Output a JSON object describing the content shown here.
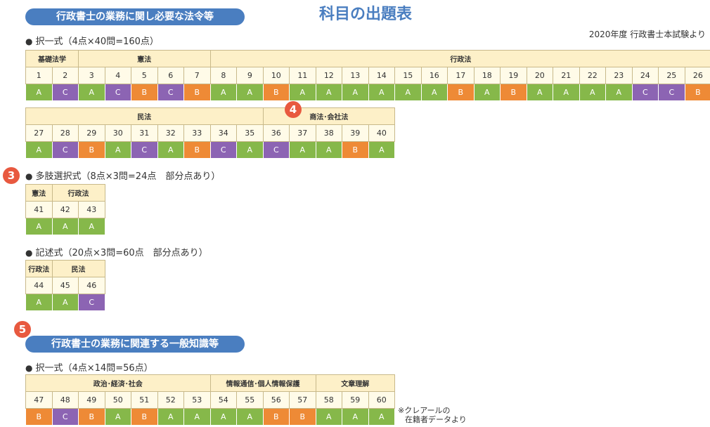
{
  "header": {
    "main_title": "科目の出題表",
    "source_note": "2020年度 行政書士本試験より",
    "section1_pill": "行政書士の業務に関し必要な法令等",
    "section2_pill": "行政書士の業務に関連する一般知識等"
  },
  "badges": {
    "b3": "3",
    "b4": "4",
    "b5": "5"
  },
  "block_choice1": {
    "heading": "択一式（4点×40問=160点）",
    "row1": {
      "groups": [
        {
          "label": "基礎法学",
          "span": 2
        },
        {
          "label": "憲法",
          "span": 5
        },
        {
          "label": "行政法",
          "span": 19
        }
      ],
      "nums": [
        "1",
        "2",
        "3",
        "4",
        "5",
        "6",
        "7",
        "8",
        "9",
        "10",
        "11",
        "12",
        "13",
        "14",
        "15",
        "16",
        "17",
        "18",
        "19",
        "20",
        "21",
        "22",
        "23",
        "24",
        "25",
        "26"
      ],
      "levels": [
        "A",
        "C",
        "A",
        "C",
        "B",
        "C",
        "B",
        "A",
        "A",
        "B",
        "A",
        "A",
        "A",
        "A",
        "A",
        "A",
        "B",
        "A",
        "B",
        "A",
        "A",
        "A",
        "A",
        "C",
        "C",
        "B"
      ]
    },
    "row2": {
      "groups": [
        {
          "label": "民法",
          "span": 9
        },
        {
          "label": "商法･会社法",
          "span": 5
        }
      ],
      "nums": [
        "27",
        "28",
        "29",
        "30",
        "31",
        "32",
        "33",
        "34",
        "35",
        "36",
        "37",
        "38",
        "39",
        "40"
      ],
      "levels": [
        "A",
        "C",
        "B",
        "A",
        "C",
        "A",
        "B",
        "C",
        "A",
        "C",
        "A",
        "A",
        "B",
        "A"
      ]
    }
  },
  "block_multi": {
    "heading": "多肢選択式（8点×3問=24点　部分点あり）",
    "groups": [
      {
        "label": "憲法",
        "span": 1
      },
      {
        "label": "行政法",
        "span": 2
      }
    ],
    "nums": [
      "41",
      "42",
      "43"
    ],
    "levels": [
      "A",
      "A",
      "A"
    ]
  },
  "block_written": {
    "heading": "記述式（20点×3問=60点　部分点あり）",
    "groups": [
      {
        "label": "行政法",
        "span": 1
      },
      {
        "label": "民法",
        "span": 2
      }
    ],
    "nums": [
      "44",
      "45",
      "46"
    ],
    "levels": [
      "A",
      "A",
      "C"
    ]
  },
  "block_general": {
    "heading": "択一式（4点×14問=56点）",
    "groups": [
      {
        "label": "政治･経済･社会",
        "span": 7
      },
      {
        "label": "情報通信･個人情報保護",
        "span": 4
      },
      {
        "label": "文章理解",
        "span": 3
      }
    ],
    "nums": [
      "47",
      "48",
      "49",
      "50",
      "51",
      "52",
      "53",
      "54",
      "55",
      "56",
      "57",
      "58",
      "59",
      "60"
    ],
    "levels": [
      "B",
      "C",
      "B",
      "A",
      "B",
      "A",
      "A",
      "A",
      "A",
      "B",
      "B",
      "A",
      "A",
      "A"
    ]
  },
  "footnote": {
    "line1": "※クレアールの",
    "line2": "在籍者データより"
  },
  "colors": {
    "A": "#86b84a",
    "B": "#ee8a36",
    "C": "#8c64b3",
    "accent": "#4a7ec0",
    "badge": "#e8593f"
  }
}
